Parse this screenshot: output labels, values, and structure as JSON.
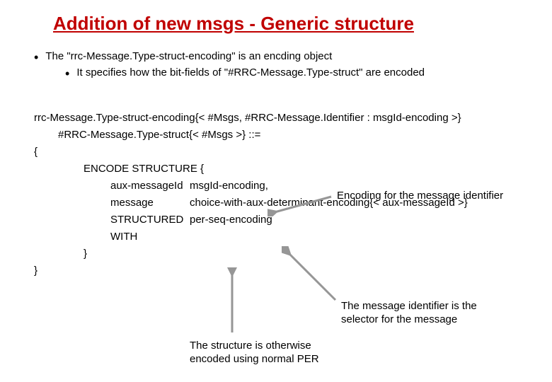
{
  "title": "Addition of new msgs - Generic structure",
  "bullets": {
    "b1": "The \"rrc-Message.Type-struct-encoding\" is an encding object",
    "b2": "It specifies how the bit-fields of \"#RRC-Message.Type-struct\" are encoded"
  },
  "code": {
    "l1": "rrc-Message.Type-struct-encoding{< #Msgs, #RRC-Message.Identifier : msgId-encoding >}",
    "l2": "#RRC-Message.Type-struct{< #Msgs >} ::=",
    "l3": "{",
    "l4": "ENCODE STRUCTURE {",
    "f1_name": "aux-messageId",
    "f1_val": "msgId-encoding,",
    "f2_name": "message",
    "f2_val": "choice-with-aux-determinant-encoding{< aux-messageId >}",
    "f3_name": "STRUCTURED WITH",
    "f3_val": "per-seq-encoding",
    "l8": "}",
    "l9": "}"
  },
  "annotations": {
    "a1": "Encoding for the message identifier",
    "a2": "The message identifier is the selector for the message",
    "a3": "The structure is otherwise encoded using normal PER"
  }
}
